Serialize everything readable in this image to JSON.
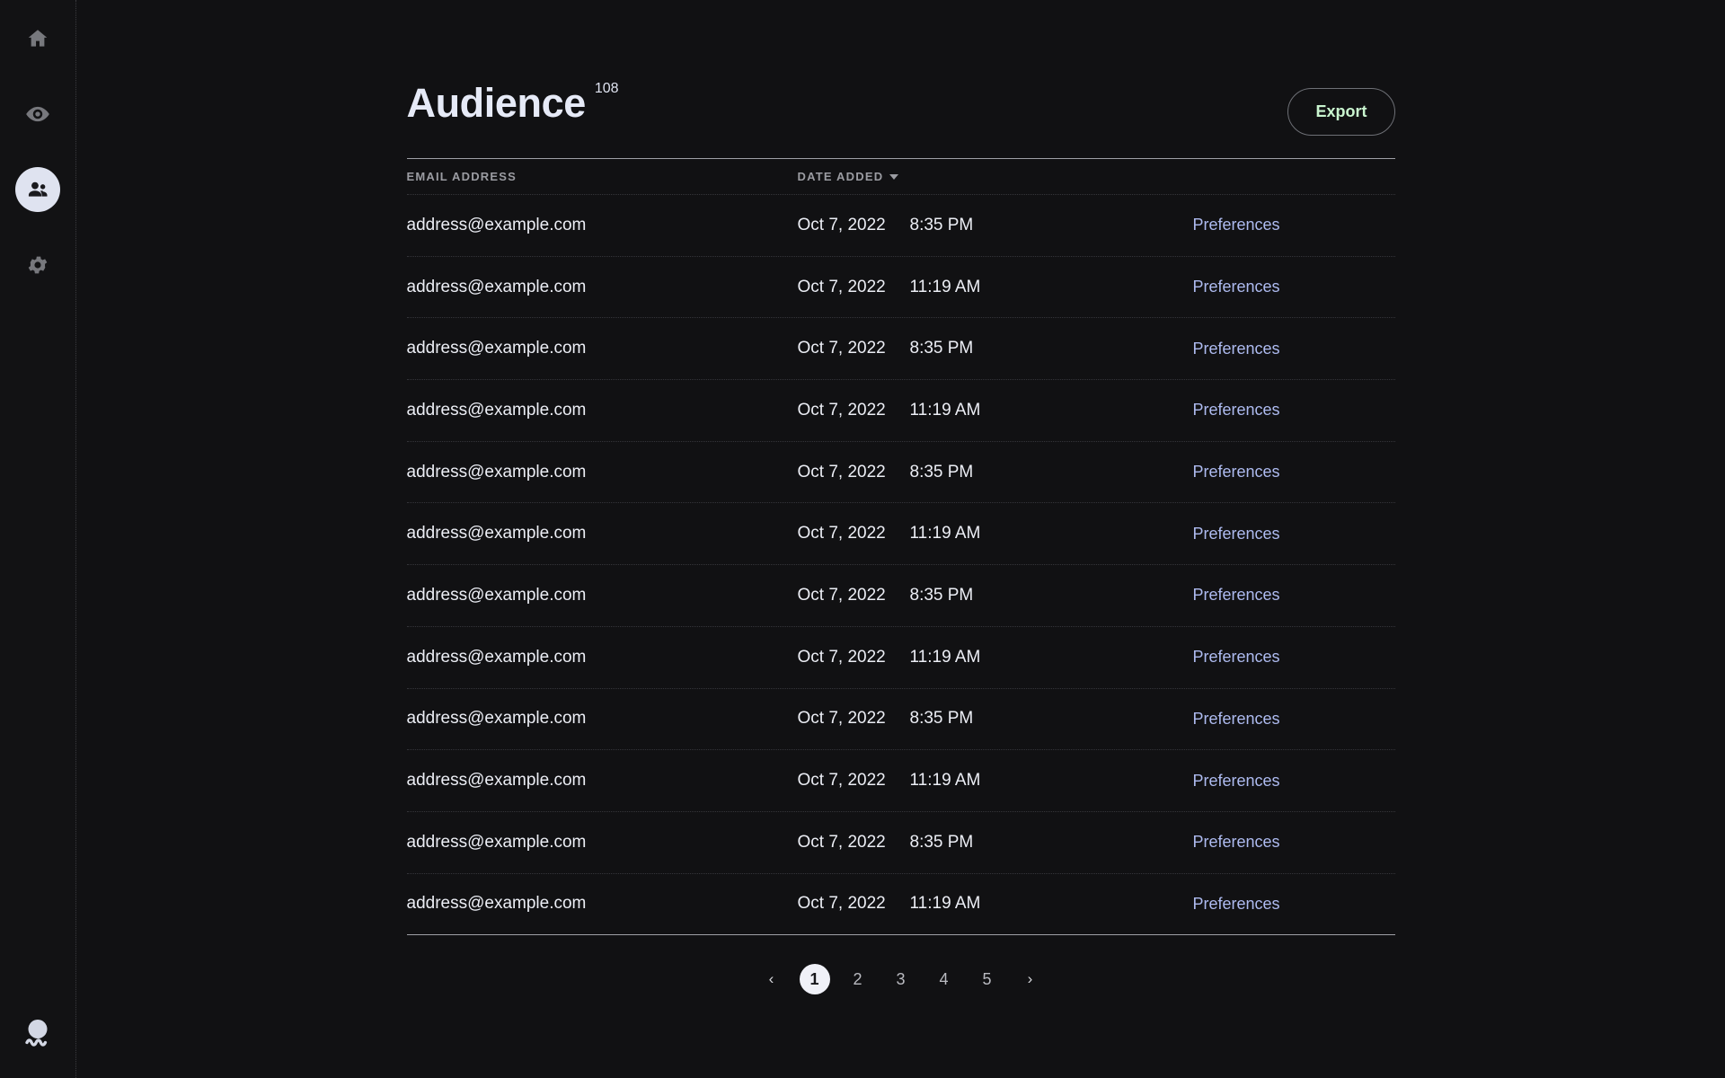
{
  "theme": {
    "background": "#111113",
    "sidebar_bg": "#121214",
    "accent_active_pill": "#dfe3f0",
    "export_text": "#c9f5cf",
    "link_color": "#aebbf0",
    "text_primary": "#eceef5",
    "text_muted": "#9b9ca2",
    "rule_color": "#9fa0a6"
  },
  "sidebar": {
    "items": [
      {
        "name": "home",
        "icon": "home-icon",
        "active": false
      },
      {
        "name": "preview",
        "icon": "eye-icon",
        "active": false
      },
      {
        "name": "audience",
        "icon": "people-icon",
        "active": true
      },
      {
        "name": "settings",
        "icon": "gear-icon",
        "active": false
      }
    ],
    "avatar": {
      "icon": "avatar-icon"
    }
  },
  "header": {
    "title": "Audience",
    "count": "108",
    "export_label": "Export"
  },
  "table": {
    "columns": [
      {
        "key": "email",
        "label": "EMAIL ADDRESS",
        "sortable": true,
        "sorted": false
      },
      {
        "key": "date",
        "label": "DATE ADDED",
        "sortable": true,
        "sorted": true,
        "sort_direction": "desc"
      },
      {
        "key": "actions",
        "label": "",
        "sortable": false,
        "sorted": false
      }
    ],
    "action_label": "Preferences",
    "rows": [
      {
        "email": "address@example.com",
        "date": "Oct 7, 2022",
        "time": "8:35 PM",
        "action": "Preferences"
      },
      {
        "email": "address@example.com",
        "date": "Oct 7, 2022",
        "time": "11:19 AM",
        "action": "Preferences"
      },
      {
        "email": "address@example.com",
        "date": "Oct 7, 2022",
        "time": "8:35 PM",
        "action": "Preferences"
      },
      {
        "email": "address@example.com",
        "date": "Oct 7, 2022",
        "time": "11:19 AM",
        "action": "Preferences"
      },
      {
        "email": "address@example.com",
        "date": "Oct 7, 2022",
        "time": "8:35 PM",
        "action": "Preferences"
      },
      {
        "email": "address@example.com",
        "date": "Oct 7, 2022",
        "time": "11:19 AM",
        "action": "Preferences"
      },
      {
        "email": "address@example.com",
        "date": "Oct 7, 2022",
        "time": "8:35 PM",
        "action": "Preferences"
      },
      {
        "email": "address@example.com",
        "date": "Oct 7, 2022",
        "time": "11:19 AM",
        "action": "Preferences"
      },
      {
        "email": "address@example.com",
        "date": "Oct 7, 2022",
        "time": "8:35 PM",
        "action": "Preferences"
      },
      {
        "email": "address@example.com",
        "date": "Oct 7, 2022",
        "time": "11:19 AM",
        "action": "Preferences"
      },
      {
        "email": "address@example.com",
        "date": "Oct 7, 2022",
        "time": "8:35 PM",
        "action": "Preferences"
      },
      {
        "email": "address@example.com",
        "date": "Oct 7, 2022",
        "time": "11:19 AM",
        "action": "Preferences"
      }
    ]
  },
  "pagination": {
    "prev_icon": "chevron-left-icon",
    "next_icon": "chevron-right-icon",
    "prev_label": "‹",
    "next_label": "›",
    "current_page": 1,
    "pages": [
      "1",
      "2",
      "3",
      "4",
      "5"
    ]
  }
}
